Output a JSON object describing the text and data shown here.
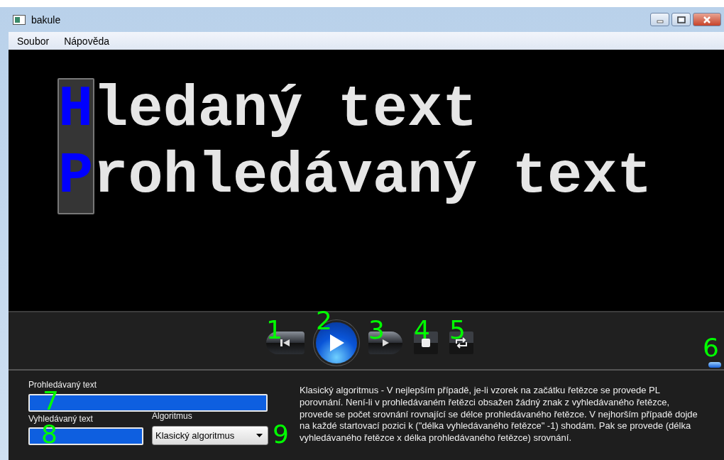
{
  "window": {
    "title": "bakule"
  },
  "menu": [
    {
      "label": "Soubor"
    },
    {
      "label": "Nápověda"
    }
  ],
  "display": {
    "lines": [
      {
        "compared": "H",
        "rest": "ledaný text"
      },
      {
        "compared": "P",
        "rest": "rohledávaný text"
      }
    ]
  },
  "controls": [
    {
      "kind": "previous",
      "annotation": "1"
    },
    {
      "kind": "play",
      "annotation": "2"
    },
    {
      "kind": "next",
      "annotation": "3"
    },
    {
      "kind": "stop",
      "annotation": "4"
    },
    {
      "kind": "repeat",
      "annotation": "5"
    }
  ],
  "handle": {
    "annotation": "6"
  },
  "form": {
    "searched_label": "Prohledávaný text",
    "searched_annotation": "7",
    "pattern_label": "Vyhledávaný text",
    "pattern_annotation": "8",
    "algorithm_label": "Algoritmus",
    "algorithm_value": "Klasický algoritmus",
    "algorithm_annotation": "9"
  },
  "description": "Klasický algoritmus - V nejlepším případě, je-li vzorek na začátku řetězce se provede PL porovnání. Není-li v prohledávaném řetězci obsažen žádný znak z vyhledávaného řetězce, provede se počet srovnání rovnající se délce prohledávaného řetězce. V nejhorším případě dojde na každé startovací pozici k (\"délka vyhledávaného řetězce\" -1) shodám. Pak se provede (délka vyhledávaného řetězce x délka prohledávaného řetězce) srovnání."
}
